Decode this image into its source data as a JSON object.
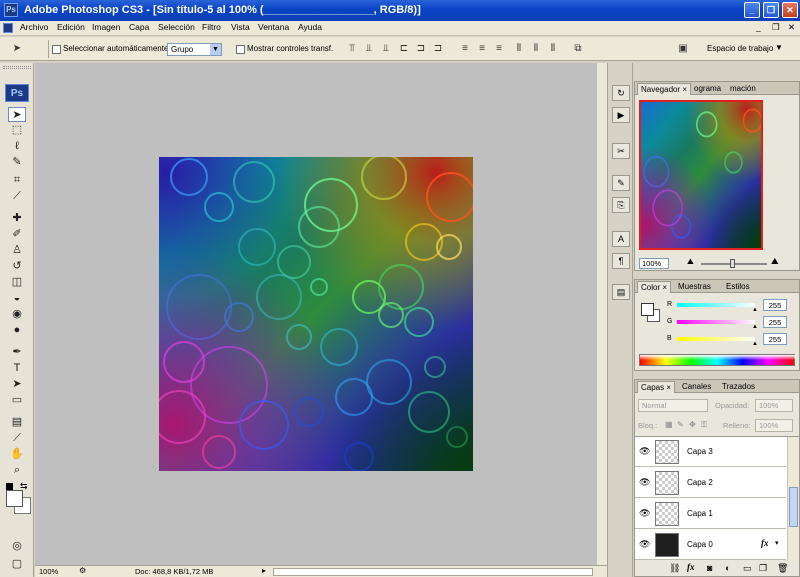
{
  "window": {
    "title": "Adobe Photoshop CS3 - [Sin título-5 al 100% (__________________, RGB/8)]",
    "logo_text": "Ps",
    "buttons": {
      "minimize": "_",
      "restore": "❐",
      "close": "✕"
    }
  },
  "menu": [
    "Archivo",
    "Edición",
    "Imagen",
    "Capa",
    "Selección",
    "Filtro",
    "Vista",
    "Ventana",
    "Ayuda"
  ],
  "options_bar": {
    "auto_select_label": "Seleccionar automáticamente:",
    "auto_select_value": "Grupo",
    "transform_label": "Mostrar controles transf.",
    "workspace_label": "Espacio de trabajo"
  },
  "toolbox": {
    "logo_text": "Ps"
  },
  "status_bar": {
    "zoom": "100%",
    "doc_info": "Doc: 468,8 KB/1,72 MB"
  },
  "navigator": {
    "tabs": [
      "Navegador",
      "Histograma",
      "Información"
    ],
    "tabs_visible": [
      "Navegador",
      "ograma",
      "mación"
    ],
    "zoom": "100%"
  },
  "color_panel": {
    "tabs": [
      "Color",
      "Muestras",
      "Estilos"
    ],
    "channels": [
      {
        "label": "R",
        "value": "255"
      },
      {
        "label": "G",
        "value": "255"
      },
      {
        "label": "B",
        "value": "255"
      }
    ]
  },
  "layers_panel": {
    "tabs": [
      "Capas",
      "Canales",
      "Trazados"
    ],
    "blend_mode": "Normal",
    "opacity_label": "Opacidad:",
    "opacity_value": "100%",
    "lock_label": "Bloq.:",
    "fill_label": "Relleno:",
    "fill_value": "100%",
    "layers": [
      {
        "name": "Capa 3",
        "visible": true
      },
      {
        "name": "Capa 2",
        "visible": true
      },
      {
        "name": "Capa 1",
        "visible": true
      },
      {
        "name": "Capa 0",
        "visible": true,
        "fx": "fx"
      }
    ],
    "bottom_icons": [
      "link-icon",
      "fx-icon",
      "mask-icon",
      "adjustment-icon",
      "group-icon",
      "new-layer-icon",
      "trash-icon"
    ]
  },
  "colors": {
    "title_blue": "#0b46c8",
    "workspace_gray": "#bfbfbf",
    "panel_bg": "#e9e7dc"
  }
}
